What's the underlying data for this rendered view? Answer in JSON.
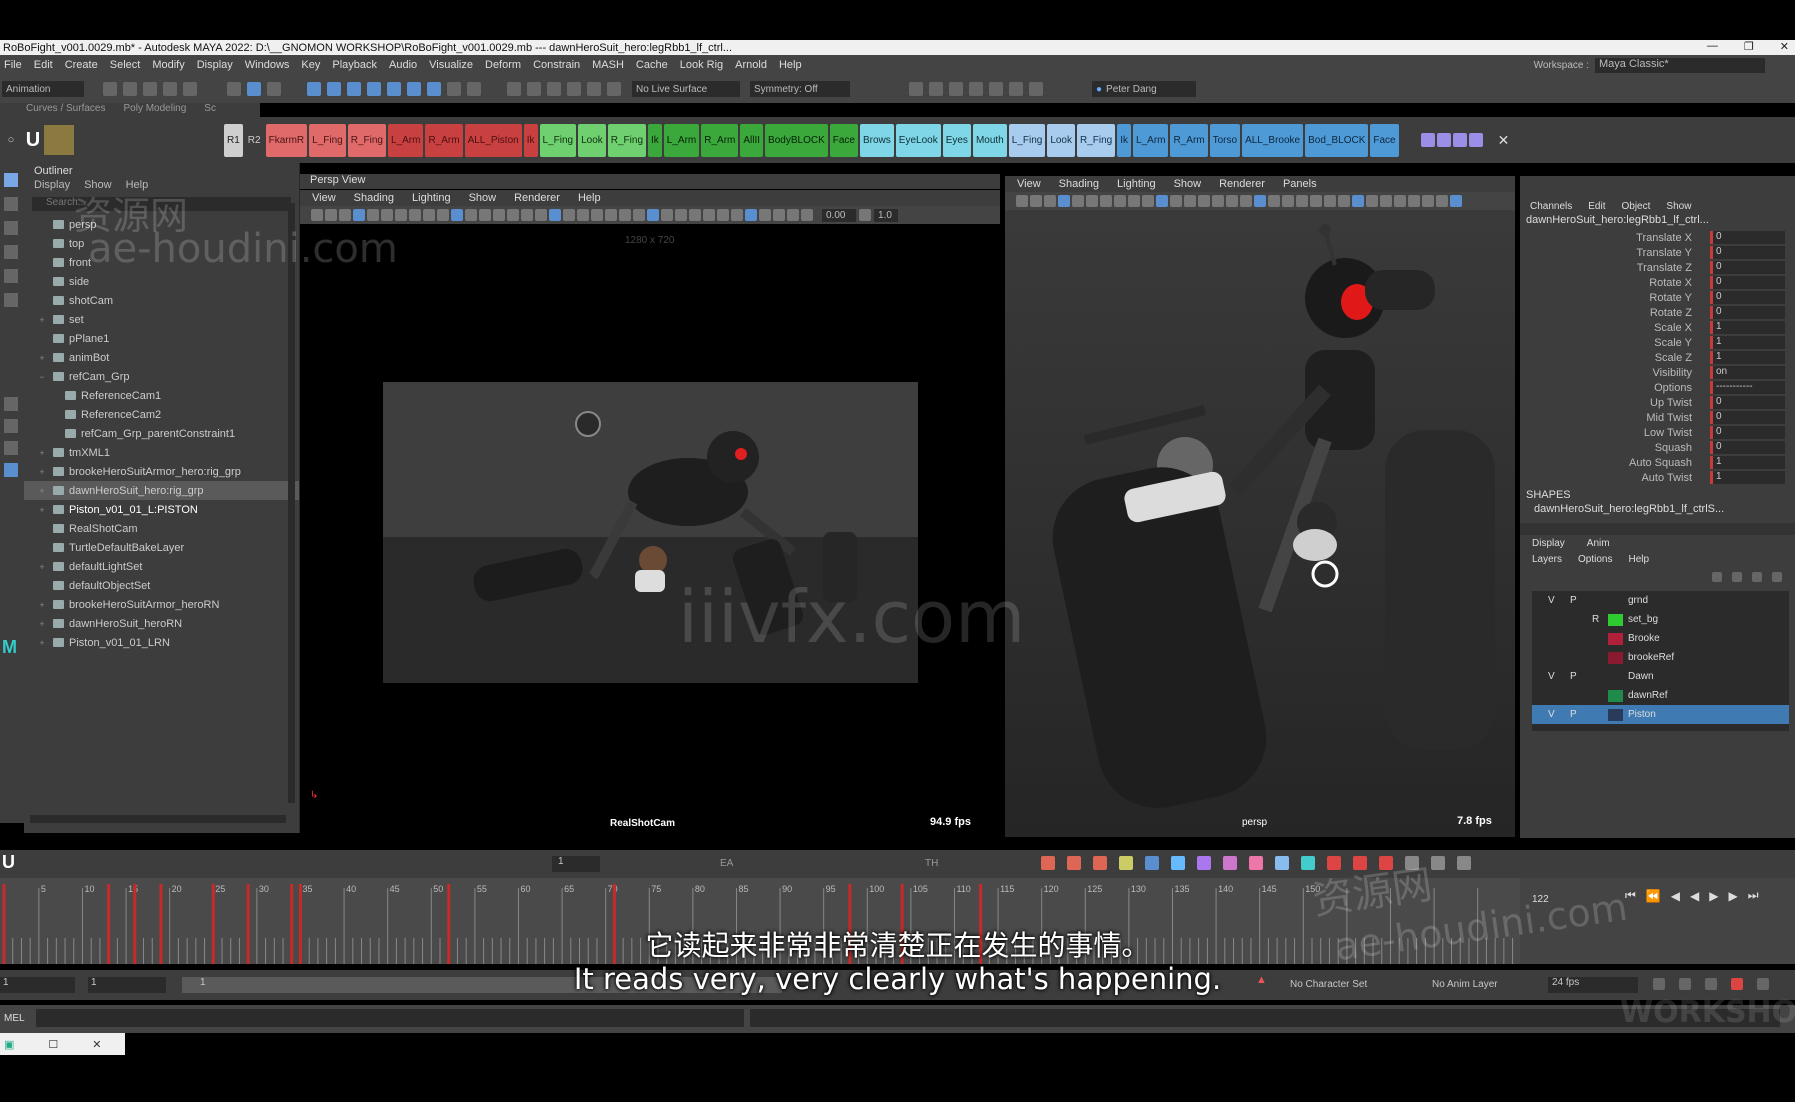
{
  "window": {
    "title": "RoBoFight_v001.0029.mb* - Autodesk MAYA 2022: D:\\__GNOMON WORKSHOP\\RoBoFight_v001.0029.mb  ---  dawnHeroSuit_hero:legRbb1_lf_ctrl..."
  },
  "menubar": {
    "items": [
      "File",
      "Edit",
      "Create",
      "Select",
      "Modify",
      "Display",
      "Windows",
      "Key",
      "Playback",
      "Audio",
      "Visualize",
      "Deform",
      "Constrain",
      "MASH",
      "Cache",
      "Look Rig",
      "Arnold",
      "Help"
    ],
    "workspace_label": "Workspace :",
    "workspace_value": "Maya Classic*"
  },
  "statusline": {
    "mode": "Animation",
    "live_surface": "No Live Surface",
    "symmetry": "Symmetry: Off",
    "user": "Peter Dang"
  },
  "shelf": {
    "tabs": [
      "Curves / Surfaces",
      "Poly Modeling",
      "Sc"
    ],
    "buttons": [
      {
        "label": "R1",
        "c": "gray"
      },
      {
        "label": "R2",
        "c": "none"
      },
      {
        "label": "FkarmR",
        "c": "red"
      },
      {
        "label": "L_Fing",
        "c": "red"
      },
      {
        "label": "R_Fing",
        "c": "red"
      },
      {
        "label": "L_Arm",
        "c": "dred"
      },
      {
        "label": "R_Arm",
        "c": "dred"
      },
      {
        "label": "ALL_Piston",
        "c": "dred"
      },
      {
        "label": "Ik",
        "c": "dred"
      },
      {
        "label": "L_Fing",
        "c": "green"
      },
      {
        "label": "Look",
        "c": "green"
      },
      {
        "label": "R_Fing",
        "c": "green"
      },
      {
        "label": "Ik",
        "c": "dgreen"
      },
      {
        "label": "L_Arm",
        "c": "dgreen"
      },
      {
        "label": "R_Arm",
        "c": "dgreen"
      },
      {
        "label": "AllII",
        "c": "dgreen"
      },
      {
        "label": "BodyBLOCK",
        "c": "dgreen"
      },
      {
        "label": "Face",
        "c": "dgreen"
      },
      {
        "label": "Brows",
        "c": "cyan"
      },
      {
        "label": "EyeLook",
        "c": "cyan"
      },
      {
        "label": "Eyes",
        "c": "cyan"
      },
      {
        "label": "Mouth",
        "c": "cyan"
      },
      {
        "label": "L_Fing",
        "c": "lblue"
      },
      {
        "label": "Look",
        "c": "lblue"
      },
      {
        "label": "R_Fing",
        "c": "lblue"
      },
      {
        "label": "Ik",
        "c": "blue"
      },
      {
        "label": "L_Arm",
        "c": "blue"
      },
      {
        "label": "R_Arm",
        "c": "blue"
      },
      {
        "label": "Torso",
        "c": "blue"
      },
      {
        "label": "ALL_Brooke",
        "c": "blue"
      },
      {
        "label": "Bod_BLOCK",
        "c": "blue"
      },
      {
        "label": "Face",
        "c": "blue"
      }
    ]
  },
  "outliner": {
    "title": "Outliner",
    "menu": [
      "Display",
      "Show",
      "Help"
    ],
    "search_placeholder": "Search...",
    "items": [
      {
        "label": "persp",
        "indent": 1,
        "toggle": ""
      },
      {
        "label": "top",
        "indent": 1,
        "toggle": ""
      },
      {
        "label": "front",
        "indent": 1,
        "toggle": ""
      },
      {
        "label": "side",
        "indent": 1,
        "toggle": ""
      },
      {
        "label": "shotCam",
        "indent": 1,
        "toggle": ""
      },
      {
        "label": "set",
        "indent": 1,
        "toggle": "+"
      },
      {
        "label": "pPlane1",
        "indent": 1,
        "toggle": ""
      },
      {
        "label": "animBot",
        "indent": 1,
        "toggle": "+"
      },
      {
        "label": "refCam_Grp",
        "indent": 1,
        "toggle": "−"
      },
      {
        "label": "ReferenceCam1",
        "indent": 2,
        "toggle": ""
      },
      {
        "label": "ReferenceCam2",
        "indent": 2,
        "toggle": ""
      },
      {
        "label": "refCam_Grp_parentConstraint1",
        "indent": 2,
        "toggle": ""
      },
      {
        "label": "tmXML1",
        "indent": 1,
        "toggle": "+"
      },
      {
        "label": "brookeHeroSuitArmor_hero:rig_grp",
        "indent": 1,
        "toggle": "+"
      },
      {
        "label": "dawnHeroSuit_hero:rig_grp",
        "indent": 1,
        "toggle": "+",
        "sel": true
      },
      {
        "label": "Piston_v01_01_L:PISTON",
        "indent": 1,
        "toggle": "+",
        "hl": true
      },
      {
        "label": "RealShotCam",
        "indent": 1,
        "toggle": ""
      },
      {
        "label": "TurtleDefaultBakeLayer",
        "indent": 1,
        "toggle": ""
      },
      {
        "label": "defaultLightSet",
        "indent": 1,
        "toggle": "+"
      },
      {
        "label": "defaultObjectSet",
        "indent": 1,
        "toggle": ""
      },
      {
        "label": "brookeHeroSuitArmor_heroRN",
        "indent": 1,
        "toggle": "+"
      },
      {
        "label": "dawnHeroSuit_heroRN",
        "indent": 1,
        "toggle": "+"
      },
      {
        "label": "Piston_v01_01_LRN",
        "indent": 1,
        "toggle": "+"
      }
    ]
  },
  "viewport1": {
    "panel_title": "Persp View",
    "menu": [
      "View",
      "Shading",
      "Lighting",
      "Show",
      "Renderer",
      "Help"
    ],
    "resolution": "1280 x 720",
    "field_a": "0.00",
    "field_b": "1.0",
    "camera": "RealShotCam",
    "fps": "94.9 fps"
  },
  "viewport2": {
    "menu": [
      "View",
      "Shading",
      "Lighting",
      "Show",
      "Renderer",
      "Panels"
    ],
    "camera": "persp",
    "fps": "7.8 fps"
  },
  "channelbox": {
    "menu": [
      "Channels",
      "Edit",
      "Object",
      "Show"
    ],
    "node": "dawnHeroSuit_hero:legRbb1_lf_ctrl...",
    "channels": [
      {
        "label": "Translate X",
        "value": "0"
      },
      {
        "label": "Translate Y",
        "value": "0"
      },
      {
        "label": "Translate Z",
        "value": "0"
      },
      {
        "label": "Rotate X",
        "value": "0"
      },
      {
        "label": "Rotate Y",
        "value": "0"
      },
      {
        "label": "Rotate Z",
        "value": "0"
      },
      {
        "label": "Scale X",
        "value": "1"
      },
      {
        "label": "Scale Y",
        "value": "1"
      },
      {
        "label": "Scale Z",
        "value": "1"
      },
      {
        "label": "Visibility",
        "value": "on"
      },
      {
        "label": "Options",
        "value": "-----------"
      },
      {
        "label": "Up Twist",
        "value": "0"
      },
      {
        "label": "Mid Twist",
        "value": "0"
      },
      {
        "label": "Low Twist",
        "value": "0"
      },
      {
        "label": "Squash",
        "value": "0"
      },
      {
        "label": "Auto Squash",
        "value": "1"
      },
      {
        "label": "Auto Twist",
        "value": "1"
      }
    ],
    "shapes_title": "SHAPES",
    "shape_node": "dawnHeroSuit_hero:legRbb1_lf_ctrlS..."
  },
  "layers": {
    "tabs": [
      "Display",
      "Anim"
    ],
    "menu": [
      "Layers",
      "Options",
      "Help"
    ],
    "rows": [
      {
        "v": "V",
        "p": "P",
        "r": "",
        "color": "",
        "name": "grnd"
      },
      {
        "v": "",
        "p": "",
        "r": "R",
        "color": "#2ecc2e",
        "name": "set_bg"
      },
      {
        "v": "",
        "p": "",
        "r": "",
        "color": "#b0203a",
        "name": "Brooke"
      },
      {
        "v": "",
        "p": "",
        "r": "",
        "color": "#8a1a30",
        "name": "brookeRef"
      },
      {
        "v": "V",
        "p": "P",
        "r": "",
        "color": "",
        "name": "Dawn"
      },
      {
        "v": "",
        "p": "",
        "r": "",
        "color": "#1f8a4a",
        "name": "dawnRef"
      },
      {
        "v": "V",
        "p": "P",
        "r": "",
        "color": "#2a3a5a",
        "name": "Piston",
        "sel": true
      }
    ]
  },
  "timebar": {
    "current_frame": "1",
    "labels": [
      "EA",
      "TH"
    ]
  },
  "timeline": {
    "ticks": [
      "5",
      "10",
      "15",
      "20",
      "25",
      "30",
      "35",
      "40",
      "45",
      "50",
      "55",
      "60",
      "65",
      "70",
      "75",
      "80",
      "85",
      "90",
      "95",
      "100",
      "105",
      "110",
      "115",
      "120",
      "125",
      "130",
      "135",
      "140",
      "145",
      "150"
    ],
    "key_frames": [
      1,
      13,
      16,
      19,
      25,
      29,
      34,
      35,
      52,
      71,
      98,
      104,
      113
    ],
    "end_frame": "122"
  },
  "range": {
    "start": "1",
    "start2": "1",
    "slider_start": "1",
    "character_set": "No Character Set",
    "anim_layer": "No Anim Layer",
    "fps": "24 fps"
  },
  "cmdline": {
    "label": "MEL"
  },
  "subtitles": {
    "zh": "它读起来非常非常清楚正在发生的事情。",
    "en": "It reads very, very clearly what's happening."
  },
  "watermarks": {
    "a": "资源网",
    "b": "ae-houdini.com",
    "c": "iiivfx.com",
    "d": "WORKSHOP"
  }
}
